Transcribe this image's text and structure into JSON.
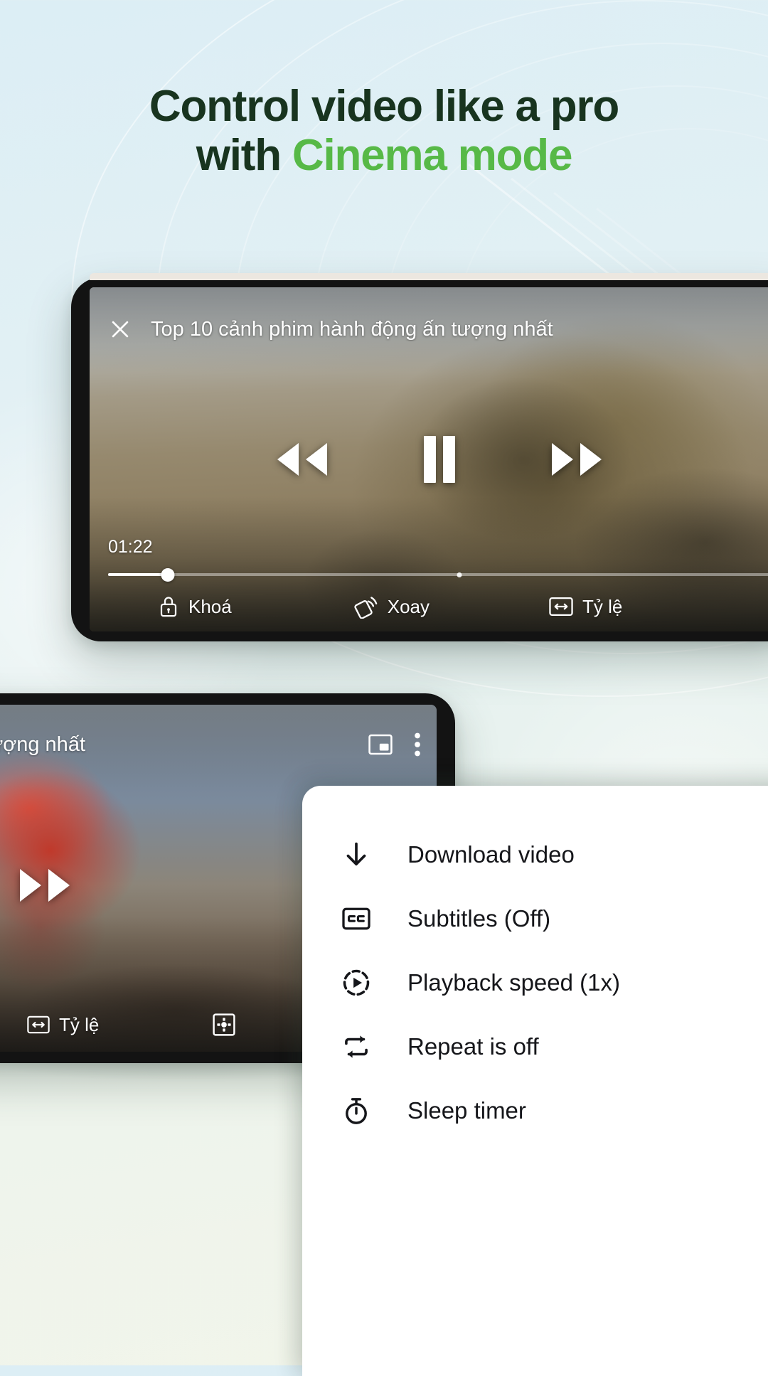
{
  "headline": {
    "line1": "Control video like a pro",
    "line2_prefix": "with ",
    "line2_highlight": "Cinema mode",
    "color_dark": "#18341f",
    "color_green": "#57b947"
  },
  "player_top": {
    "close_icon": "close-icon",
    "title": "Top 10 cảnh phim hành động ấn tượng nhất",
    "transport": {
      "rewind_icon": "rewind-icon",
      "pause_icon": "pause-icon",
      "forward_icon": "fast-forward-icon"
    },
    "current_time": "01:22",
    "progress_percent": 9,
    "chapter_marker_percent": 53,
    "actions": [
      {
        "icon": "lock-icon",
        "label": "Khoá"
      },
      {
        "icon": "rotate-icon",
        "label": "Xoay"
      },
      {
        "icon": "aspect-ratio-icon",
        "label": "Tỷ lệ"
      }
    ]
  },
  "player_bottom": {
    "title": "ộng ấn tượng nhất",
    "pip_icon": "picture-in-picture-icon",
    "more_icon": "kebab-menu-icon",
    "transport": {
      "pause_icon": "pause-icon",
      "forward_icon": "fast-forward-icon"
    },
    "actions": [
      {
        "icon": "aspect-ratio-icon",
        "label": "Tỷ lệ"
      },
      {
        "icon": "settings-icon",
        "label": ""
      }
    ]
  },
  "menu": {
    "items": [
      {
        "icon": "download-icon",
        "label": "Download video"
      },
      {
        "icon": "closed-caption-icon",
        "label": "Subtitles (Off)"
      },
      {
        "icon": "playback-speed-icon",
        "label": "Playback speed (1x)"
      },
      {
        "icon": "repeat-icon",
        "label": "Repeat is off"
      },
      {
        "icon": "sleep-timer-icon",
        "label": "Sleep timer"
      }
    ]
  }
}
